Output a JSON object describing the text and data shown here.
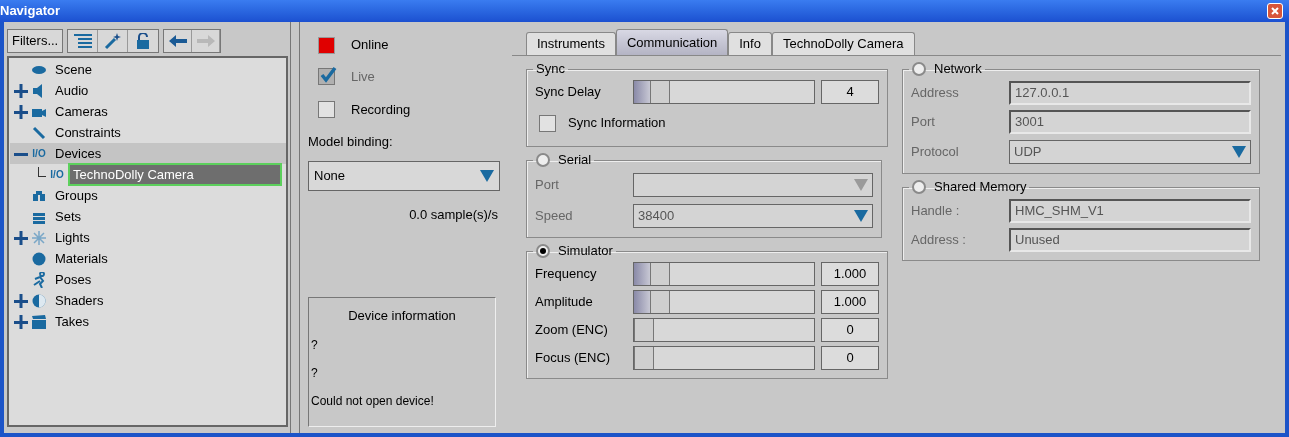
{
  "window": {
    "title": "Navigator"
  },
  "toolbar": {
    "filters": "Filters...",
    "nav": [
      {
        "kind": "back",
        "disabled": false
      },
      {
        "kind": "forward",
        "disabled": true
      }
    ]
  },
  "tree": [
    {
      "label": "Scene",
      "kind": "leaf",
      "selected": false,
      "highlighted": false
    },
    {
      "label": "Audio",
      "kind": "branch",
      "expanded": false,
      "selected": false,
      "highlighted": false
    },
    {
      "label": "Cameras",
      "kind": "branch",
      "expanded": false,
      "selected": false,
      "highlighted": false
    },
    {
      "label": "Constraints",
      "kind": "leaf",
      "selected": false,
      "highlighted": false
    },
    {
      "label": "Devices",
      "icon_text": "I/O",
      "kind": "branch",
      "expanded": true,
      "selected": false,
      "highlighted": true,
      "children": [
        {
          "label": "TechnoDolly Camera",
          "icon_text": "I/O",
          "selected": true
        }
      ]
    },
    {
      "label": "Groups",
      "kind": "leaf",
      "selected": false,
      "highlighted": false
    },
    {
      "label": "Sets",
      "kind": "leaf",
      "selected": false,
      "highlighted": false
    },
    {
      "label": "Lights",
      "kind": "branch",
      "expanded": false,
      "selected": false,
      "highlighted": false
    },
    {
      "label": "Materials",
      "kind": "leaf",
      "selected": false,
      "highlighted": false
    },
    {
      "label": "Poses",
      "kind": "leaf",
      "selected": false,
      "highlighted": false
    },
    {
      "label": "Shaders",
      "kind": "branch",
      "expanded": false,
      "selected": false,
      "highlighted": false
    },
    {
      "label": "Takes",
      "kind": "branch",
      "expanded": false,
      "selected": false,
      "highlighted": false
    }
  ],
  "device": {
    "online": {
      "label": "Online",
      "color": "#e00000"
    },
    "options": [
      {
        "label": "Live",
        "checked": true,
        "disabled": true
      },
      {
        "label": "Recording",
        "checked": false,
        "disabled": false
      }
    ],
    "model_binding": {
      "label": "Model binding:",
      "value": "None"
    },
    "rate": "0.0 sample(s)/s",
    "info": {
      "title": "Device information",
      "lines": [
        "?",
        "?",
        "Could not open device!"
      ]
    }
  },
  "tabs": [
    {
      "label": "Instruments",
      "selected": false
    },
    {
      "label": "Communication",
      "selected": true
    },
    {
      "label": "Info",
      "selected": false
    },
    {
      "label": "TechnoDolly Camera",
      "selected": false
    }
  ],
  "columns": [
    [
      {
        "title": "Sync",
        "kind": "plain",
        "rows": [
          {
            "kind": "slider",
            "label": "Sync Delay",
            "level": 0.1,
            "value": "4"
          },
          {
            "kind": "checkbox",
            "label": "Sync Information",
            "checked": false
          }
        ]
      },
      {
        "title": "Serial",
        "kind": "radio",
        "selected": false,
        "rows": [
          {
            "kind": "dropdown",
            "label": "Port",
            "disabled": true
          },
          {
            "kind": "dropdown",
            "label": "Speed",
            "value": "38400",
            "disabled": false
          }
        ]
      },
      {
        "title": "Simulator",
        "kind": "radio",
        "selected": true,
        "rows": [
          {
            "kind": "slider",
            "label": "Frequency",
            "level": 0.1,
            "value": "1.000"
          },
          {
            "kind": "slider",
            "label": "Amplitude",
            "level": 0.1,
            "value": "1.000"
          },
          {
            "kind": "slider",
            "label": "Zoom (ENC)",
            "level": 0,
            "value": "0"
          },
          {
            "kind": "slider",
            "label": "Focus (ENC)",
            "level": 0,
            "value": "0"
          }
        ]
      }
    ],
    [
      {
        "title": "Network",
        "kind": "radio",
        "selected": false,
        "rows": [
          {
            "kind": "text",
            "label": "Address",
            "value": "127.0.0.1"
          },
          {
            "kind": "text",
            "label": "Port",
            "value": "3001"
          },
          {
            "kind": "dropdown",
            "label": "Protocol",
            "value": "UDP",
            "disabled": false
          }
        ]
      },
      {
        "title": "Shared Memory",
        "kind": "radio",
        "selected": false,
        "rows": [
          {
            "kind": "text",
            "label": "Handle :",
            "value": "HMC_SHM_V1"
          },
          {
            "kind": "text",
            "label": "Address :",
            "value": "Unused"
          }
        ]
      }
    ]
  ]
}
